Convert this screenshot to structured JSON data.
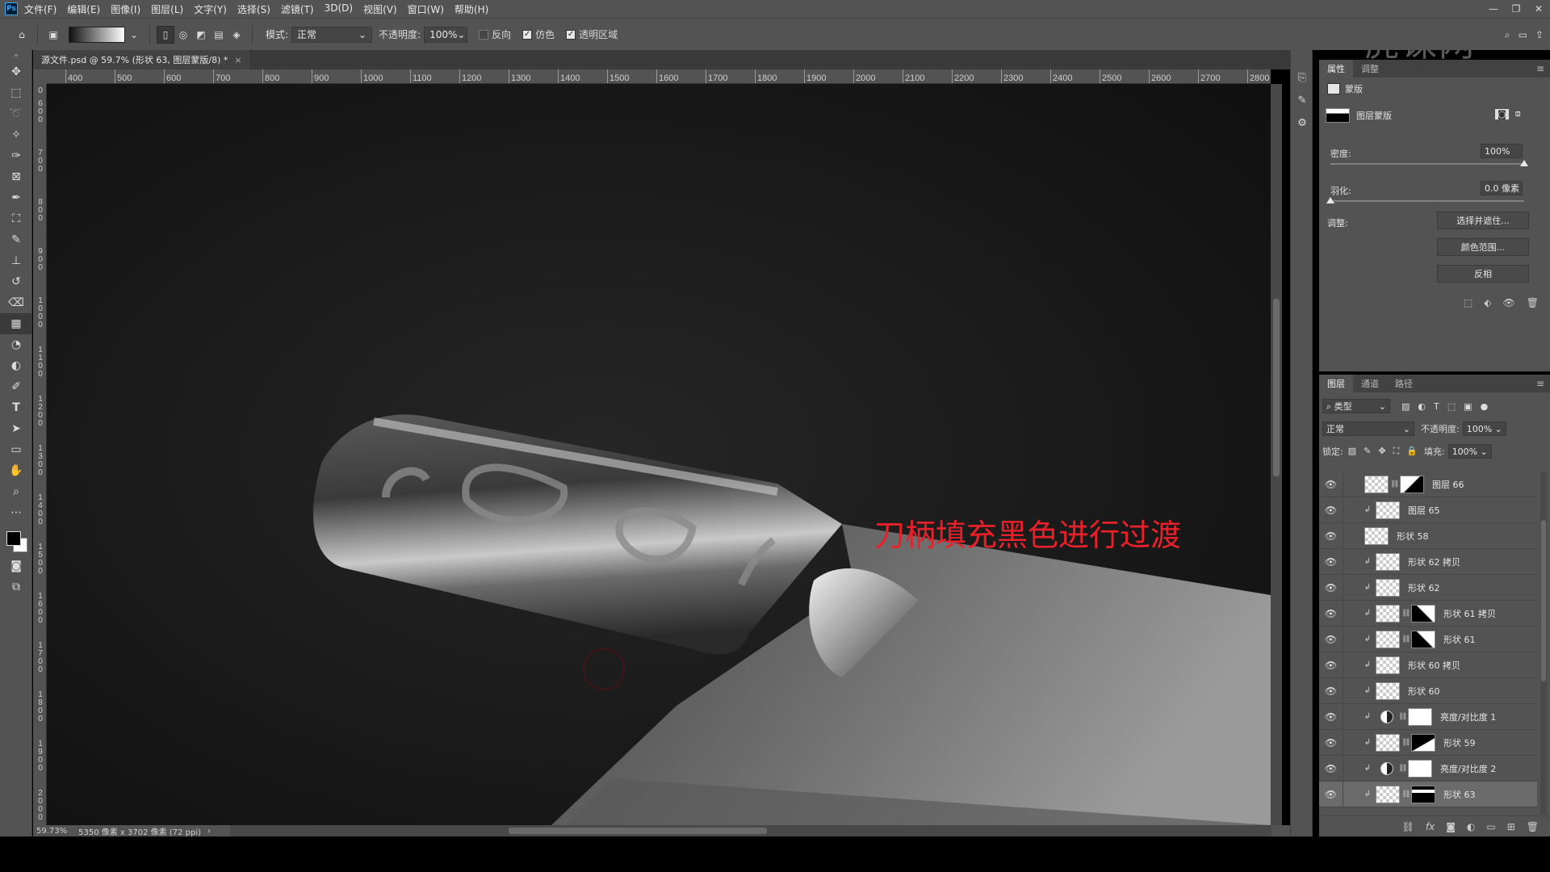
{
  "menubar": {
    "logo": "Ps",
    "items": [
      "文件(F)",
      "编辑(E)",
      "图像(I)",
      "图层(L)",
      "文字(Y)",
      "选择(S)",
      "滤镜(T)",
      "3D(D)",
      "视图(V)",
      "窗口(W)",
      "帮助(H)"
    ]
  },
  "options": {
    "mode_label": "模式:",
    "mode_value": "正常",
    "opacity_label": "不透明度:",
    "opacity_value": "100%",
    "reverse_label": "反向",
    "reverse_checked": false,
    "dither_label": "仿色",
    "dither_checked": true,
    "transparency_label": "透明区域",
    "transparency_checked": true
  },
  "document": {
    "tab_title": "源文件.psd @ 59.7% (形状 63, 图层蒙版/8) *",
    "ruler_top": [
      "400",
      "500",
      "600",
      "700",
      "800",
      "900",
      "1000",
      "1100",
      "1200",
      "1300",
      "1400",
      "1500",
      "1600",
      "1700",
      "1800",
      "1900",
      "2000",
      "2100",
      "2200",
      "2300",
      "2400",
      "2500",
      "2600",
      "2700",
      "2800"
    ],
    "ruler_left": [
      "0",
      "6 0 0",
      "7 0 0",
      "8 0 0",
      "9 0 0",
      "1 0 0 0",
      "1 1 0 0",
      "1 2 0 0",
      "1 3 0 0",
      "1 4 0 0",
      "1 5 0 0",
      "1 6 0 0",
      "1 7 0 0",
      "1 8 0 0",
      "1 9 0 0",
      "2 0 0 0"
    ],
    "annotation": "刀柄填充黑色进行过渡",
    "status_zoom": "59.73%",
    "status_info": "5350 像素 x 3702 像素 (72 ppi)"
  },
  "properties": {
    "tabs": [
      "属性",
      "调整"
    ],
    "section": "蒙版",
    "mask_name": "图层蒙版",
    "density_label": "密度:",
    "density_value": "100%",
    "density_level": 1.0,
    "feather_label": "羽化:",
    "feather_value": "0.0 像素",
    "feather_level": 0.0,
    "adjust_label": "调整:",
    "buttons": [
      "选择并遮住...",
      "颜色范围...",
      "反相"
    ]
  },
  "layers": {
    "tabs": [
      "图层",
      "通道",
      "路径"
    ],
    "filter_value": "类型",
    "blend_value": "正常",
    "opacity_label": "不透明度:",
    "opacity_value": "100%",
    "lock_label": "锁定:",
    "fill_label": "填充:",
    "fill_value": "100%",
    "rows": [
      {
        "name": "图层 66",
        "clipped": false,
        "type": "pixel",
        "mask": "diag"
      },
      {
        "name": "图层 65",
        "clipped": true,
        "type": "pixel",
        "mask": ""
      },
      {
        "name": "形状 58",
        "clipped": false,
        "type": "shape",
        "mask": ""
      },
      {
        "name": "形状 62 拷贝",
        "clipped": true,
        "type": "shape",
        "mask": ""
      },
      {
        "name": "形状 62",
        "clipped": true,
        "type": "shape",
        "mask": ""
      },
      {
        "name": "形状 61 拷贝",
        "clipped": true,
        "type": "shape",
        "mask": "diag2"
      },
      {
        "name": "形状 61",
        "clipped": true,
        "type": "shape",
        "mask": "diag2"
      },
      {
        "name": "形状 60 拷贝",
        "clipped": true,
        "type": "shape",
        "mask": ""
      },
      {
        "name": "形状 60",
        "clipped": true,
        "type": "shape",
        "mask": ""
      },
      {
        "name": "亮度/对比度 1",
        "clipped": true,
        "type": "adjust",
        "mask": "white"
      },
      {
        "name": "形状 59",
        "clipped": true,
        "type": "shape",
        "mask": "blackdiag"
      },
      {
        "name": "亮度/对比度 2",
        "clipped": true,
        "type": "adjust",
        "mask": "white"
      },
      {
        "name": "形状 63",
        "clipped": true,
        "type": "shape",
        "mask": "mask63",
        "selected": true
      }
    ]
  },
  "watermark": "虎课网"
}
